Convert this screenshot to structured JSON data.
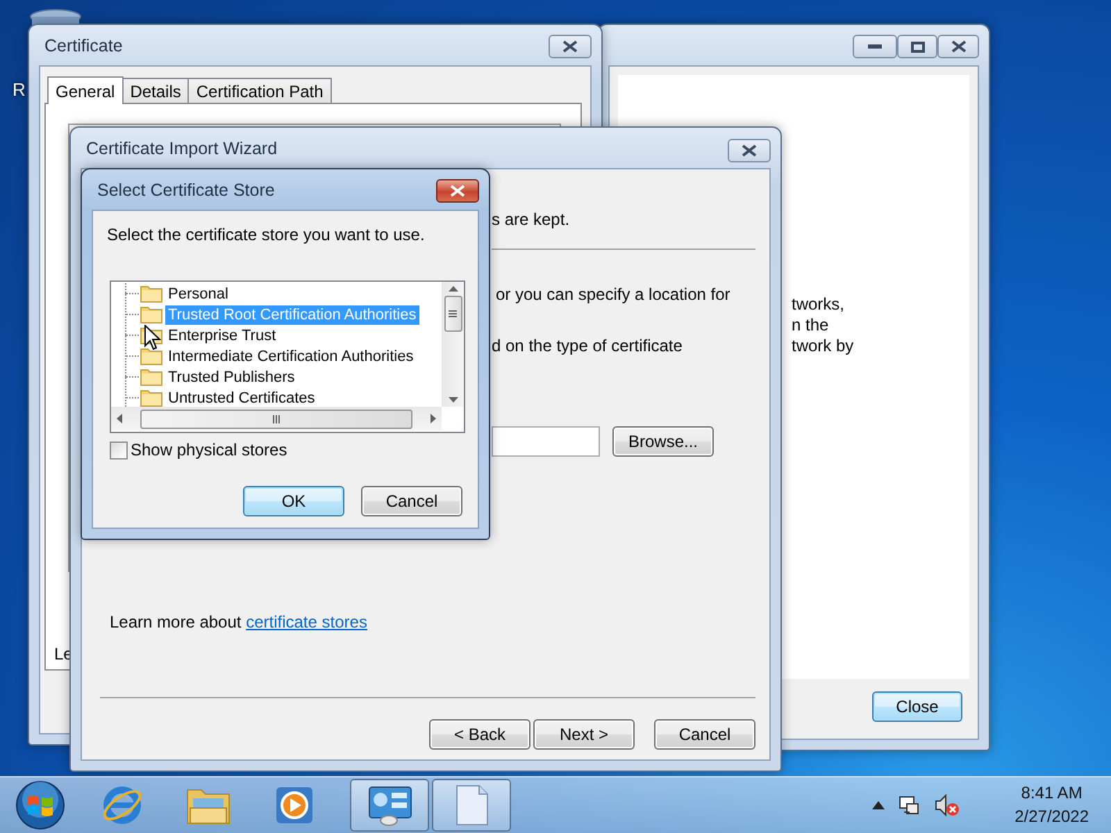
{
  "desktop": {
    "icon_label": "R"
  },
  "background_window": {
    "text_lines": [
      "tworks,",
      "n the",
      "twork by"
    ],
    "buttons": [
      {
        "label": "Close",
        "default": true
      }
    ]
  },
  "certificate_window": {
    "title": "Certificate",
    "tabs": [
      {
        "label": "General",
        "selected": true
      },
      {
        "label": "Details",
        "selected": false
      },
      {
        "label": "Certification Path",
        "selected": false
      }
    ],
    "panel_text": "Le"
  },
  "import_wizard": {
    "title": "Certificate Import Wizard",
    "text_fragments": [
      "s are kept.",
      "or you can specify a location for",
      "d on the type of certificate"
    ],
    "browse_button": "Browse...",
    "learn_more": {
      "text": "Learn more about",
      "link": "certificate stores"
    },
    "buttons": [
      {
        "label": "< Back",
        "default": false
      },
      {
        "label": "Next >",
        "default": false
      },
      {
        "label": "Cancel",
        "default": false
      }
    ]
  },
  "store_dialog": {
    "title": "Select Certificate Store",
    "instruction": "Select the certificate store you want to use.",
    "stores": [
      {
        "label": "Personal",
        "selected": false
      },
      {
        "label": "Trusted Root Certification Authorities",
        "selected": true
      },
      {
        "label": "Enterprise Trust",
        "selected": false
      },
      {
        "label": "Intermediate Certification Authorities",
        "selected": false
      },
      {
        "label": "Trusted Publishers",
        "selected": false
      },
      {
        "label": "Untrusted Certificates",
        "selected": false
      }
    ],
    "show_physical_stores": {
      "label": "Show physical stores",
      "checked": false
    },
    "buttons": [
      {
        "label": "OK",
        "default": true
      },
      {
        "label": "Cancel",
        "default": false
      }
    ]
  },
  "taskbar": {
    "items": [
      {
        "kind": "start",
        "active": false
      },
      {
        "kind": "browser",
        "active": false
      },
      {
        "kind": "folder",
        "active": false
      },
      {
        "kind": "media",
        "active": false
      },
      {
        "kind": "control-panel",
        "active": true
      },
      {
        "kind": "document",
        "active": true
      }
    ],
    "volume": {
      "muted": true
    },
    "clock": {
      "time": "8:41 AM",
      "date": "2/27/2022"
    }
  }
}
